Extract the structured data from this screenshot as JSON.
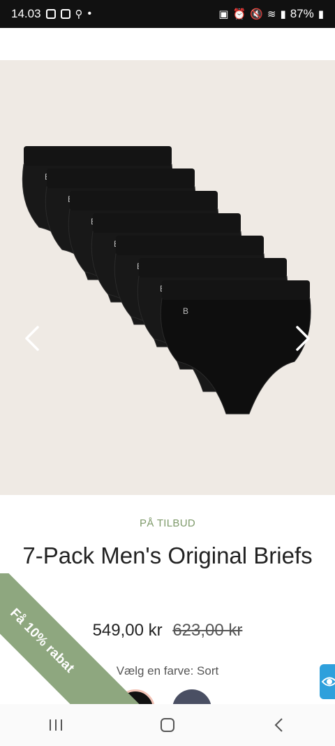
{
  "status_bar": {
    "time": "14.03",
    "battery": "87%"
  },
  "gallery": {
    "alt_subject": "briefs"
  },
  "product": {
    "sale_label": "PÅ TILBUD",
    "title": "7-Pack Men's Original Briefs",
    "price": "549,00 kr",
    "old_price": "623,00 kr",
    "color_label": "Vælg en farve: Sort",
    "swatches": [
      {
        "name": "Sort",
        "color": "#111111"
      },
      {
        "name": "Navy",
        "color": "#4a4f63"
      }
    ]
  },
  "promo": {
    "ribbon_text": "Få 10% rabat",
    "ribbon_color": "#8ea77f"
  },
  "colors": {
    "accent_green": "#7e9a6a",
    "a11y_blue": "#2ea0dc",
    "image_bg": "#efeae4"
  }
}
